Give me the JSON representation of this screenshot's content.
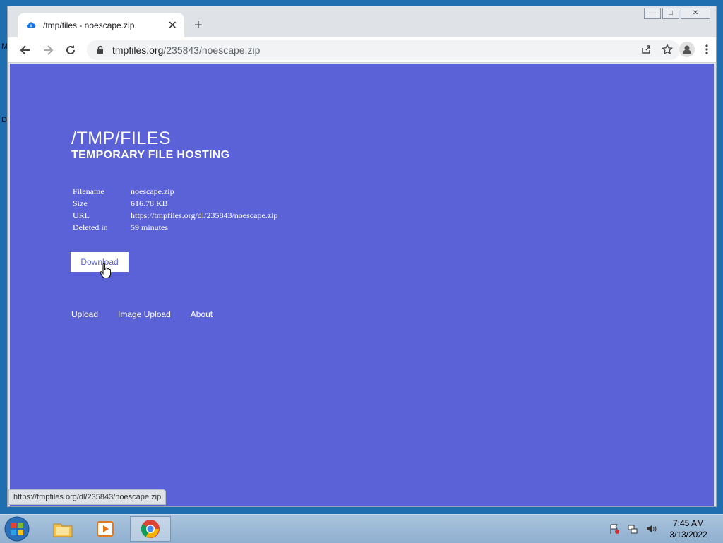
{
  "desktop": {
    "edge_letters": [
      "M",
      "D"
    ]
  },
  "browser": {
    "tab_title": "/tmp/files - noescape.zip",
    "url_host": "tmpfiles.org",
    "url_path": "/235843/noescape.zip"
  },
  "page": {
    "title": "/TMP/FILES",
    "subtitle": "TEMPORARY FILE HOSTING",
    "info_rows": [
      {
        "label": "Filename",
        "value": "noescape.zip"
      },
      {
        "label": "Size",
        "value": "616.78 KB"
      },
      {
        "label": "URL",
        "value": "https://tmpfiles.org/dl/235843/noescape.zip"
      },
      {
        "label": "Deleted in",
        "value": "59 minutes"
      }
    ],
    "download_label": "Download",
    "footer_links": [
      "Upload",
      "Image Upload",
      "About"
    ]
  },
  "status_bar": "https://tmpfiles.org/dl/235843/noescape.zip",
  "taskbar": {
    "time": "7:45 AM",
    "date": "3/13/2022"
  },
  "colors": {
    "page_bg": "#5b62d8",
    "accent_blue": "#1a73e8"
  }
}
